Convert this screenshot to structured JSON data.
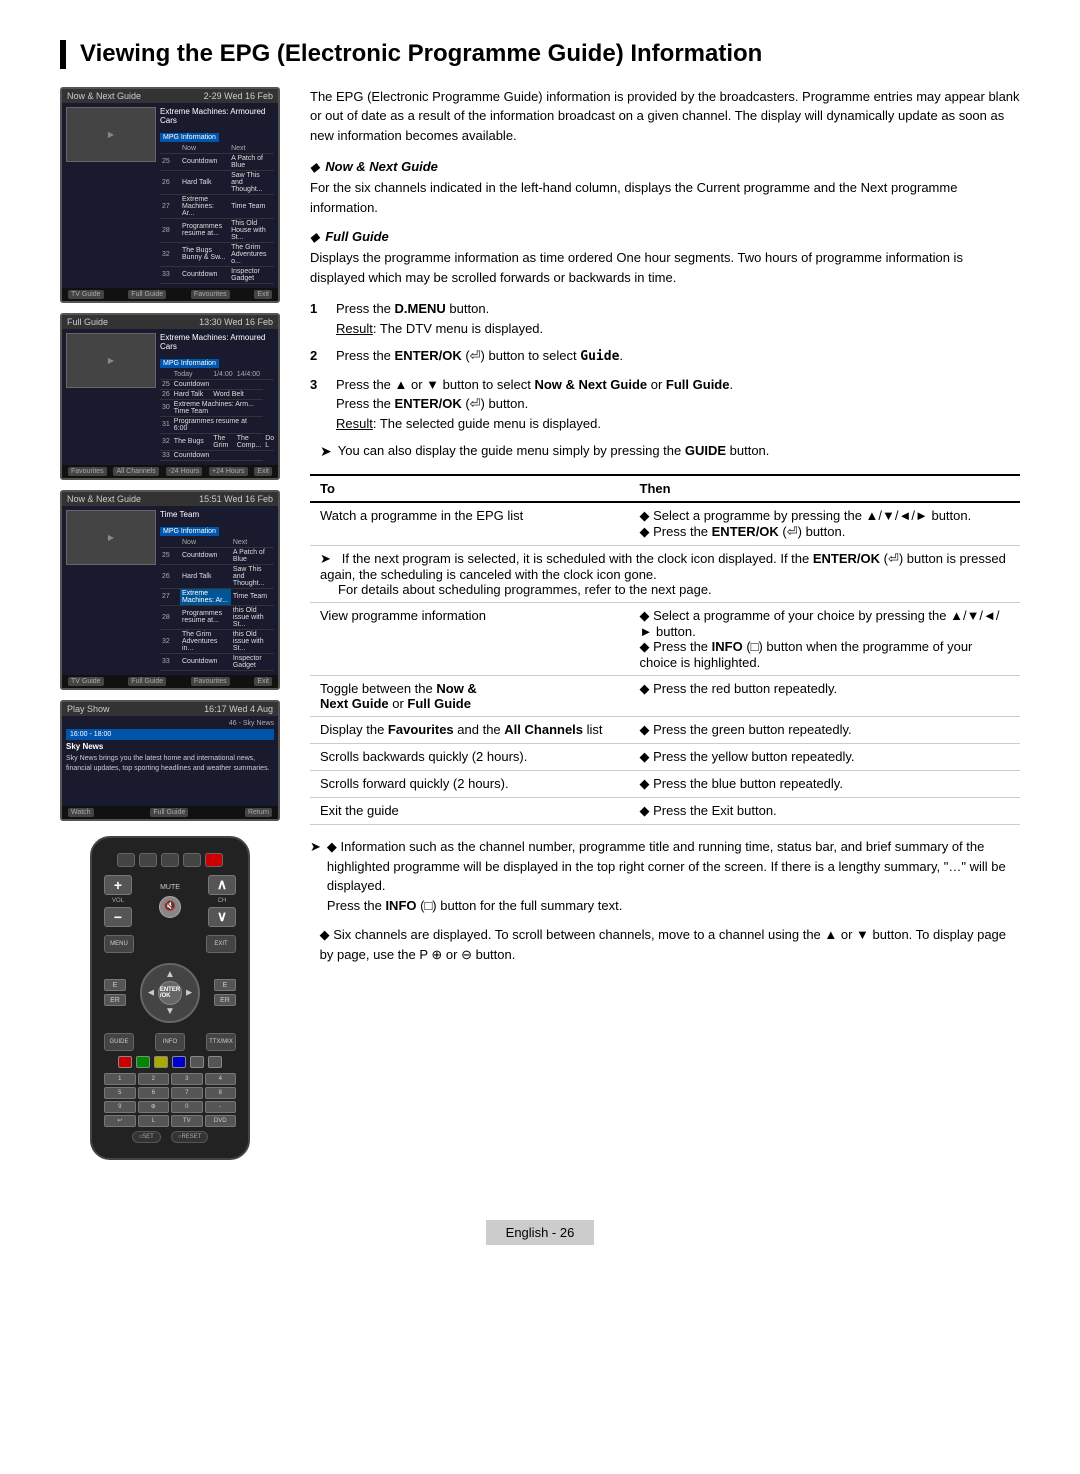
{
  "title": "Viewing the EPG (Electronic Programme Guide) Information",
  "intro": "The EPG (Electronic Programme Guide) information is provided by the broadcasters. Programme entries may appear blank or out of date as a result of the information broadcast on a given channel. The display will dynamically update as soon as new information becomes available.",
  "sections": {
    "now_next": {
      "title": "Now & Next Guide",
      "body": "For the six channels indicated in the left-hand column, displays the Current programme and the Next programme information."
    },
    "full_guide": {
      "title": "Full Guide",
      "body": "Displays the programme information as time ordered One hour segments. Two hours of programme information is displayed which may be scrolled forwards or backwards in time."
    }
  },
  "steps": [
    {
      "num": "1",
      "text": "Press the D.MENU button.",
      "result": "Result: The DTV menu is displayed."
    },
    {
      "num": "2",
      "text": "Press the ENTER/OK (⏎) button to select Guide."
    },
    {
      "num": "3",
      "text": "Press the ▲ or ▼ button to select Now & Next Guide or Full Guide.",
      "result2": "Press the ENTER/OK (⏎) button.",
      "result": "Result: The selected guide menu is displayed."
    }
  ],
  "note1": "You can also display the guide menu simply by pressing the GUIDE button.",
  "table": {
    "headers": [
      "To",
      "Then"
    ],
    "rows": [
      {
        "to": "Watch a programme in the EPG list",
        "then": "◆ Select a programme by pressing the ▲/▼/◄/► button.\n◆ Press the ENTER/OK (⏎) button."
      },
      {
        "to_note": "If the next program is selected, it is scheduled with the clock icon displayed. If the ENTER/OK (⏎) button is pressed again, the scheduling is canceled with the clock icon gone.",
        "then_note": "For details about scheduling programmes, refer to the next page."
      },
      {
        "to": "View programme information",
        "then": "◆ Select a programme of your choice by pressing the ▲/▼/◄/► button.\n◆ Press the INFO (ℹ) button when the programme of your choice is highlighted."
      },
      {
        "to_bold": "Toggle between the Now & Next Guide or Full Guide",
        "then": "◆ Press the red button repeatedly."
      },
      {
        "to_bold": "Display the Favourites and the All Channels list",
        "then": "◆ Press the green button repeatedly."
      },
      {
        "to": "Scrolls backwards quickly (2 hours).",
        "then": "◆ Press the yellow button repeatedly."
      },
      {
        "to": "Scrolls forward quickly (2 hours).",
        "then": "◆ Press the blue button repeatedly."
      },
      {
        "to": "Exit the guide",
        "then": "◆ Press the Exit button."
      }
    ]
  },
  "bottom_notes": [
    "◆ Information such as the channel number, programme title and running time, status bar, and brief summary of the highlighted programme will be displayed in the top right corner of the screen. If there is a lengthy summary, \"…\" will be displayed. Press the INFO (ℹ) button for the full summary text.",
    "◆ Six channels are displayed. To scroll between channels, move to a channel using the ▲ or ▼ button. To display page by page, use the P ⊕ or ⊖ button."
  ],
  "footer": {
    "label": "English",
    "page": "- 26"
  },
  "screens": [
    {
      "header": "Now & Next Guide",
      "date": "2-29 Wed 16 Feb",
      "program": "Extreme Machines: Armoured Cars"
    },
    {
      "header": "Full Guide",
      "date": "13:30 Wed 16 Feb",
      "program": "Extreme Machines: Armoured Cars"
    },
    {
      "header": "Now & Next Guide",
      "date": "15:51 Wed 16 Feb",
      "program": "Time Team"
    },
    {
      "header": "Play Show",
      "date": "16:17 Wed 4 Aug",
      "program": "Sky News"
    }
  ]
}
